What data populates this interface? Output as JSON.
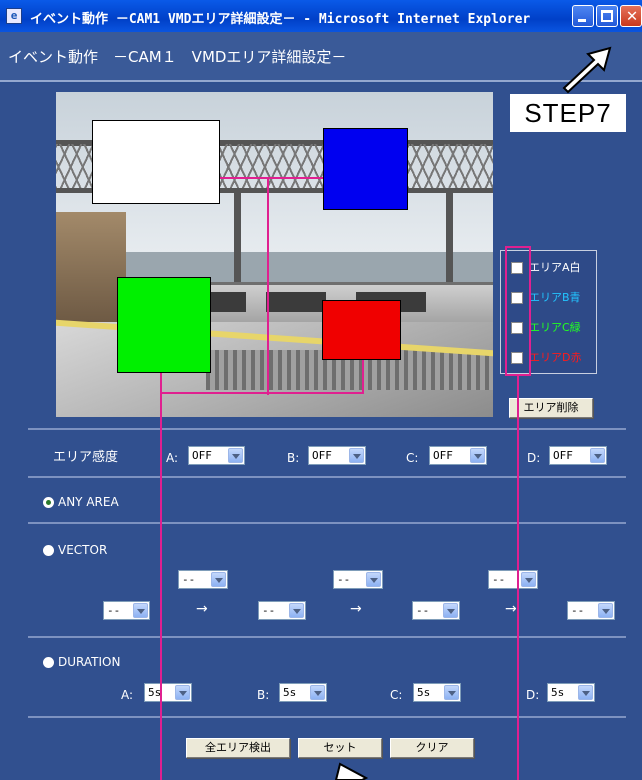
{
  "window": {
    "title": "イベント動作 －CAM1 VMDエリア詳細設定－ - Microsoft Internet Explorer",
    "icon": "ie-icon",
    "close_glyph": "✕"
  },
  "header": {
    "title": "イベント動作　－CAM１　VMDエリア詳細設定－"
  },
  "annotation": {
    "step_label": "STEP7"
  },
  "areas": [
    {
      "id": "A",
      "label": "エリアA白",
      "color": "#ffffff",
      "label_color": "#ffffff"
    },
    {
      "id": "B",
      "label": "エリアB青",
      "color": "#0000f0",
      "label_color": "#22c4ff"
    },
    {
      "id": "C",
      "label": "エリアC緑",
      "color": "#00f000",
      "label_color": "#22ff22"
    },
    {
      "id": "D",
      "label": "エリアD赤",
      "color": "#f00000",
      "label_color": "#ff1a1a"
    }
  ],
  "buttons": {
    "delete_area": "エリア削除",
    "detect_all": "全エリア検出",
    "set": "セット",
    "clear": "クリア"
  },
  "sensitivity": {
    "label": "エリア感度",
    "items": [
      {
        "prefix": "A:",
        "value": "OFF"
      },
      {
        "prefix": "B:",
        "value": "OFF"
      },
      {
        "prefix": "C:",
        "value": "OFF"
      },
      {
        "prefix": "D:",
        "value": "OFF"
      }
    ]
  },
  "modes": {
    "any_area": "ANY AREA",
    "vector": "VECTOR",
    "duration": "DURATION",
    "selected": "any_area"
  },
  "vector": {
    "top_values": [
      "--",
      "--",
      "--"
    ],
    "bottom_values": [
      "--",
      "--",
      "--",
      "--"
    ],
    "arrow": "→"
  },
  "duration": {
    "items": [
      {
        "prefix": "A:",
        "value": "5s"
      },
      {
        "prefix": "B:",
        "value": "5s"
      },
      {
        "prefix": "C:",
        "value": "5s"
      },
      {
        "prefix": "D:",
        "value": "5s"
      }
    ]
  },
  "colors": {
    "background": "#31508f",
    "accent": "#e02090"
  }
}
